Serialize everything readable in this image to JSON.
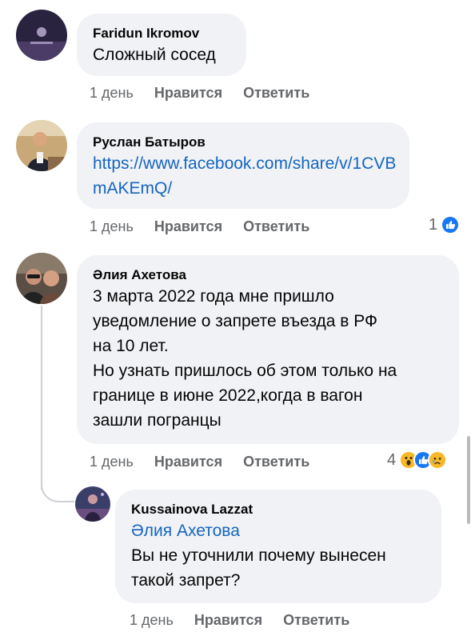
{
  "comments": [
    {
      "author": "Faridun Ikromov",
      "text": "Сложный сосед",
      "time": "1 день",
      "like_label": "Нравится",
      "reply_label": "Ответить"
    },
    {
      "author": "Руслан Батыров",
      "link": "https://www.facebook.com/share/v/1CVBmAKEmQ/",
      "time": "1 день",
      "like_label": "Нравится",
      "reply_label": "Ответить",
      "reaction_count": "1",
      "reactions": [
        "like-icon"
      ]
    },
    {
      "author": "Әлия Ахетова",
      "text": "3 марта 2022 года мне пришло\nуведомление о запрете въезда в РФ\nна 10 лет.\nНо узнать пришлось об этом только на\nгранице в июне 2022,когда в вагон\nзашли погранцы",
      "time": "1 день",
      "like_label": "Нравится",
      "reply_label": "Ответить",
      "reaction_count": "4",
      "reactions": [
        "wow-icon",
        "like-icon",
        "sad-icon"
      ]
    }
  ],
  "reply": {
    "author": "Kussainova Lazzat",
    "mention": "Әлия Ахетова",
    "text": "Вы не уточнили почему вынесен\nтакой запрет?",
    "time": "1 день",
    "like_label": "Нравится",
    "reply_label": "Ответить"
  },
  "colors": {
    "bubble": "#f0f2f5",
    "link": "#1565c0",
    "meta": "#65676b",
    "like": "#1877f2"
  }
}
